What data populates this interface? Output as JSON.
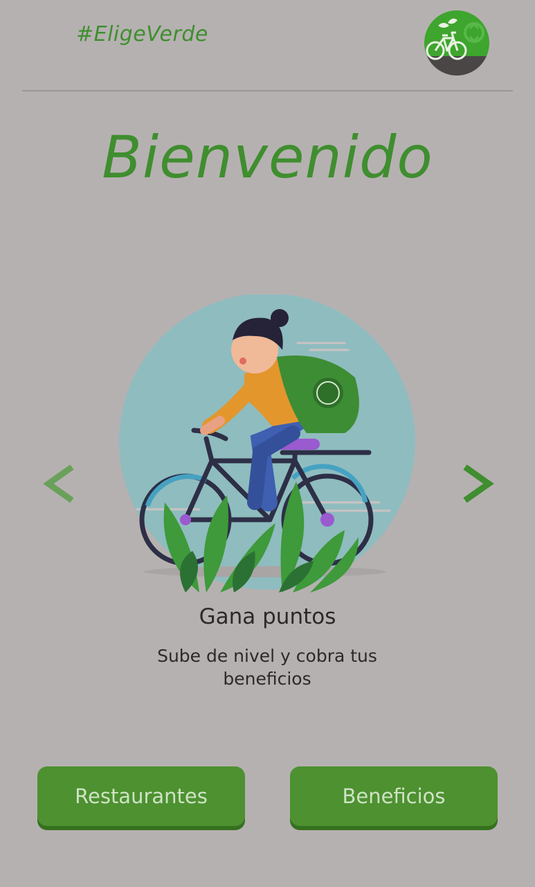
{
  "header": {
    "hashtag": "#EligeVerde",
    "logo_icon": "eco-bike-logo-icon"
  },
  "welcome": {
    "title": "Bienvenido"
  },
  "carousel": {
    "prev_icon": "chevron-left-icon",
    "next_icon": "chevron-right-icon",
    "illustration": "cyclist-illustration",
    "slide": {
      "title": "Gana puntos",
      "description": "Sube de nivel y cobra tus beneficios"
    }
  },
  "actions": {
    "restaurants_label": "Restaurantes",
    "benefits_label": "Beneficios"
  },
  "colors": {
    "background": "#b6b1b1",
    "brand_green": "#3f8e2f",
    "button_green": "#4d9131",
    "text_dark": "#2d2929"
  }
}
